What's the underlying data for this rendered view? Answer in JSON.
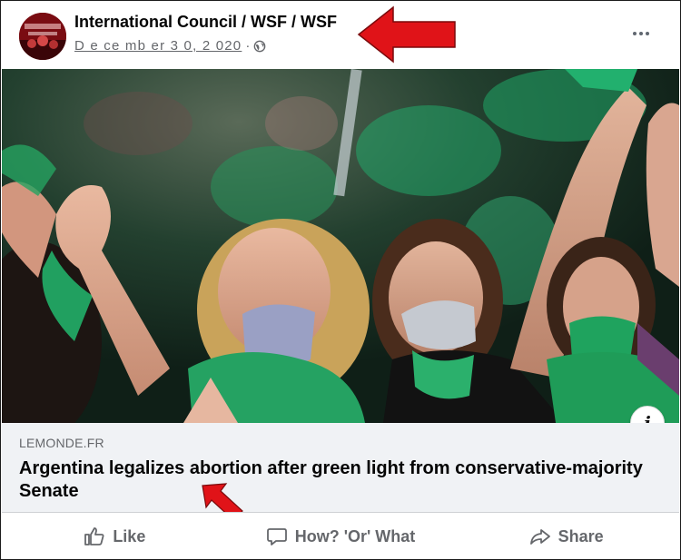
{
  "post": {
    "page_name": "International Council / WSF / WSF",
    "date": "D e ce mb er 3 0, 2 020",
    "separator": "·",
    "visibility_icon": "globe-icon",
    "more_icon": "more-options-icon"
  },
  "link_preview": {
    "domain": "LEMONDE.FR",
    "title": "Argentina legalizes abortion after green light from conservative-majority Senate",
    "info_icon_label": "i"
  },
  "actions": {
    "like": "Like",
    "comment": "How? 'Or' What",
    "share": "Share"
  },
  "colors": {
    "annotation_arrow": "#e01318",
    "protest_green": "#1aa366",
    "link_background": "#f0f2f5",
    "secondary_text": "#65676b"
  }
}
